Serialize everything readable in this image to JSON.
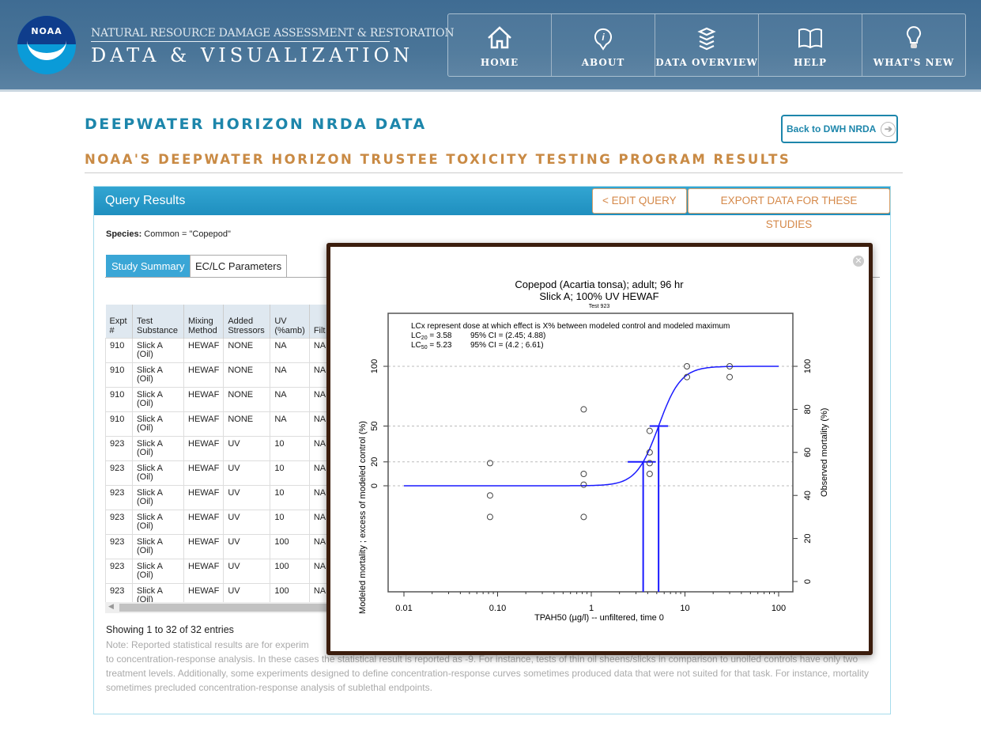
{
  "header": {
    "logo_text": "NOAA",
    "subtitle": "NATURAL RESOURCE DAMAGE ASSESSMENT & RESTORATION",
    "title": "DATA & VISUALIZATION",
    "nav": [
      {
        "label": "HOME",
        "icon": "home-icon"
      },
      {
        "label": "ABOUT",
        "icon": "info-icon"
      },
      {
        "label": "DATA OVERVIEW",
        "icon": "layers-icon"
      },
      {
        "label": "HELP",
        "icon": "book-icon"
      },
      {
        "label": "WHAT'S NEW",
        "icon": "lightbulb-icon"
      }
    ]
  },
  "page": {
    "title": "DEEPWATER HORIZON NRDA DATA",
    "subtitle": "NOAA'S DEEPWATER HORIZON TRUSTEE TOXICITY TESTING PROGRAM RESULTS",
    "back_label": "Back to DWH NRDA"
  },
  "panel": {
    "title": "Query Results",
    "edit_label": "< EDIT QUERY",
    "export_label": "EXPORT DATA FOR THESE STUDIES",
    "species_label": "Species:",
    "species_value": " Common = \"Copepod\"",
    "tabs": [
      "Study Summary",
      "EC/LC Parameters"
    ],
    "columns": [
      "Expt #",
      "Test Substance",
      "Mixing Method",
      "Added Stressors",
      "UV (%amb)",
      "Filt"
    ],
    "rows": [
      [
        "910",
        "Slick A (Oil)",
        "HEWAF",
        "NONE",
        "NA",
        "NA"
      ],
      [
        "910",
        "Slick A (Oil)",
        "HEWAF",
        "NONE",
        "NA",
        "NA"
      ],
      [
        "910",
        "Slick A (Oil)",
        "HEWAF",
        "NONE",
        "NA",
        "NA"
      ],
      [
        "910",
        "Slick A (Oil)",
        "HEWAF",
        "NONE",
        "NA",
        "NA"
      ],
      [
        "923",
        "Slick A (Oil)",
        "HEWAF",
        "UV",
        "10",
        "NA"
      ],
      [
        "923",
        "Slick A (Oil)",
        "HEWAF",
        "UV",
        "10",
        "NA"
      ],
      [
        "923",
        "Slick A (Oil)",
        "HEWAF",
        "UV",
        "10",
        "NA"
      ],
      [
        "923",
        "Slick A (Oil)",
        "HEWAF",
        "UV",
        "10",
        "NA"
      ],
      [
        "923",
        "Slick A (Oil)",
        "HEWAF",
        "UV",
        "100",
        "NA"
      ],
      [
        "923",
        "Slick A (Oil)",
        "HEWAF",
        "UV",
        "100",
        "NA"
      ],
      [
        "923",
        "Slick A (Oil)",
        "HEWAF",
        "UV",
        "100",
        "NA"
      ]
    ],
    "showing": "Showing 1 to 32 of 32 entries",
    "note_line1": "Note: Reported statistical results are for experim",
    "note_rest": "to concentration-response analysis. In these cases the statistical result is reported as -9. For instance, tests of thin oil sheens/slicks in comparison to unoiled controls have only two treatment levels. Additionally, some experiments designed to define concentration-response curves sometimes produced data that were not suited for that task. For instance, mortality sometimes precluded concentration-response analysis of sublethal endpoints."
  },
  "colors": {
    "teal": "#1d86ab",
    "orange": "#c98a44",
    "curve": "#1a1aff",
    "modal_border": "#3b1d0d"
  },
  "chart_data": {
    "type": "scatter",
    "title": "Copepod (Acartia tonsa); adult; 96 hr",
    "subtitle": "Slick A; 100% UV HEWAF",
    "test_label": "Test  923",
    "xlabel": "TPAH50 (µg/l) -- unfiltered, time 0",
    "ylabel_left": "Modeled mortality ; excess of modeled control (%)",
    "ylabel_right": "Observed mortality  (%)",
    "xscale": "log",
    "xlim": [
      0.01,
      100
    ],
    "xticks": [
      "0.01",
      "0.10",
      "1",
      "10",
      "100"
    ],
    "yticks_left": [
      0,
      20,
      50,
      100
    ],
    "yticks_right": [
      0,
      20,
      40,
      60,
      80,
      100
    ],
    "ylim_right": [
      -5,
      125
    ],
    "control_observed": 44.6,
    "annotation": "LCx represent dose at which effect is X% between modeled control and modeled maximum",
    "lc": [
      {
        "label": "LC",
        "sub": "20",
        "value": 3.58,
        "ci_text": "95% CI = (2.45; 4.88)",
        "ci": [
          2.45,
          4.88
        ],
        "level": 20
      },
      {
        "label": "LC",
        "sub": "50",
        "value": 5.23,
        "ci_text": "95% CI = (4.2 ; 6.61)",
        "ci": [
          4.2,
          6.61
        ],
        "level": 50
      }
    ],
    "points": [
      {
        "x": 0.083,
        "y": 55
      },
      {
        "x": 0.083,
        "y": 40
      },
      {
        "x": 0.083,
        "y": 30
      },
      {
        "x": 0.83,
        "y": 80
      },
      {
        "x": 0.83,
        "y": 50
      },
      {
        "x": 0.83,
        "y": 45
      },
      {
        "x": 0.83,
        "y": 30
      },
      {
        "x": 4.2,
        "y": 70
      },
      {
        "x": 4.2,
        "y": 60
      },
      {
        "x": 4.2,
        "y": 55
      },
      {
        "x": 4.2,
        "y": 50
      },
      {
        "x": 10.5,
        "y": 100
      },
      {
        "x": 10.5,
        "y": 95
      },
      {
        "x": 30,
        "y": 100
      },
      {
        "x": 30,
        "y": 95
      }
    ],
    "grid": "dashed at left ticks"
  }
}
